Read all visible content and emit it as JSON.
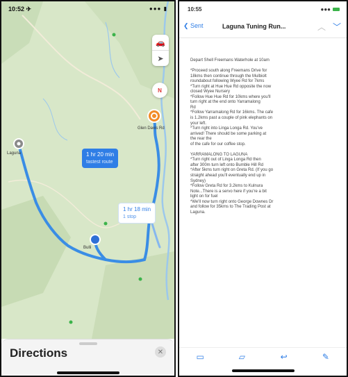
{
  "left_phone": {
    "status_time": "10:52 ✈",
    "status_icons": "●●● ▮",
    "map_controls": [
      "car-icon",
      "location-arrow-icon"
    ],
    "compass_label": "N",
    "route_selected": {
      "time": "1 hr 20 min",
      "sub": "fastest route"
    },
    "route_alt": {
      "time": "1 hr 18 min",
      "sub": "1 stop"
    },
    "places": {
      "start": "Laguna",
      "end": "Glen Davis Rd",
      "mid": "Bulli"
    },
    "sheet_title": "Directions",
    "close_icon_label": "✕"
  },
  "right_phone": {
    "status_time": "10:55",
    "status_icons": "●●●",
    "nav": {
      "back": "Sent",
      "subject": "Laguna Tuning Run...",
      "up_icon": "︿",
      "down_icon": "﹀"
    },
    "body_lines": [
      "Depart Shell Freemans Waterhole at 10am",
      "",
      "*Proceed south along Freemans Drive for",
      "18kms then continue through the Mulbiolt",
      "roundabout following Wyee Rd for 7kms",
      "*Turn right at Hue Hue Rd opposite the now",
      "closed Wyee Nursery",
      "*Follow Hue Hue Rd for 10kms where you'll",
      "    turn right at the end onto Yarramalong",
      "Rd",
      "*Follow Yarramalong Rd for 16kms. The cafe",
      "is 1.2kms past a couple of pink elephants on",
      "your   left.",
      "*Turn right into Linga Longa Rd. You've",
      "arrived!  There should be some parking  at",
      "the rear the",
      " of the cafe for our coffee stop.",
      "",
      "YARRAMALONG TO LAGUNA",
      "*Turn right out of Linga Longa Rd then",
      " after 300m turn left onto Bumble Hill Rd",
      "*After 5kms turn right on Greta Rd. (If you go",
      "straight ahead you'll eventually end up in",
      "Sydney)",
      "*Follow Greta Rd for 3.2kms to Kulnura",
      "Note...There is a servo here if you're a bit",
      "light on for fuel",
      "*We'll now turn right onto George Downes Dr",
      "and follow for 35kms to The Trading Post at",
      "Laguna."
    ],
    "toolbar": [
      "archive-icon",
      "folder-icon",
      "reply-icon",
      "compose-icon"
    ]
  }
}
